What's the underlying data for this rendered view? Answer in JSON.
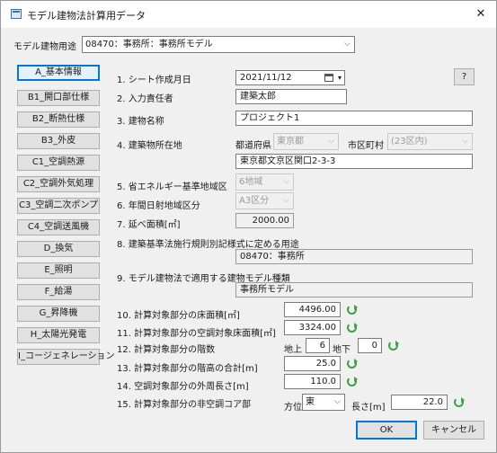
{
  "window": {
    "title": "モデル建物法計算用データ",
    "close": "✕"
  },
  "usage": {
    "label": "モデル建物用途",
    "value": "08470：事務所：事務所モデル"
  },
  "tabs": [
    "A_基本情報",
    "B1_開口部仕様",
    "B2_断熱仕様",
    "B3_外皮",
    "C1_空調熱源",
    "C2_空調外気処理",
    "C3_空調二次ポンプ",
    "C4_空調送風機",
    "D_換気",
    "E_照明",
    "F_給湯",
    "G_昇降機",
    "H_太陽光発電",
    "I_コージェネレーション"
  ],
  "active_tab": "A_基本情報",
  "form": {
    "help": "?",
    "r1": {
      "label": "1. シート作成月日",
      "value": "2021/11/12"
    },
    "r2": {
      "label": "2. 入力責任者",
      "value": "建築太郎"
    },
    "r3": {
      "label": "3. 建物名称",
      "value": "プロジェクト1"
    },
    "r4": {
      "label": "4. 建築物所在地",
      "pref_label": "都道府県",
      "pref_value": "東京都",
      "city_label": "市区町村",
      "city_value": "(23区内)",
      "address": "東京都文京区関口2-3-3"
    },
    "r5": {
      "label": "5. 省エネルギー基準地域区",
      "value": "6地域"
    },
    "r6": {
      "label": "6. 年間日射地域区分",
      "value": "A3区分"
    },
    "r7": {
      "label": "7. 延べ面積[㎡]",
      "value": "2000.00"
    },
    "r8": {
      "label": "8. 建築基準法施行規則別記様式に定める用途",
      "value": "08470：事務所"
    },
    "r9": {
      "label": "9. モデル建物法で適用する建物モデル種類",
      "value": "事務所モデル"
    },
    "r10": {
      "label": "10. 計算対象部分の床面積[㎡]",
      "value": "4496.00"
    },
    "r11": {
      "label": "11. 計算対象部分の空調対象床面積[㎡]",
      "value": "3324.00"
    },
    "r12": {
      "label": "12. 計算対象部分の階数",
      "above_label": "地上",
      "above_value": "6",
      "below_label": "地下",
      "below_value": "0"
    },
    "r13": {
      "label": "13. 計算対象部分の階高の合計[m]",
      "value": "25.0"
    },
    "r14": {
      "label": "14. 空調対象部分の外周長さ[m]",
      "value": "110.0"
    },
    "r15": {
      "label": "15. 計算対象部分の非空調コア部",
      "dir_label": "方位",
      "dir_value": "東",
      "len_label": "長さ[m]",
      "len_value": "22.0"
    }
  },
  "buttons": {
    "ok": "OK",
    "cancel": "キャンセル"
  },
  "icons": {
    "calendar": "calendar-icon",
    "refresh": "refresh-icon",
    "chevron": "chevron-down-icon",
    "close": "close-icon"
  }
}
